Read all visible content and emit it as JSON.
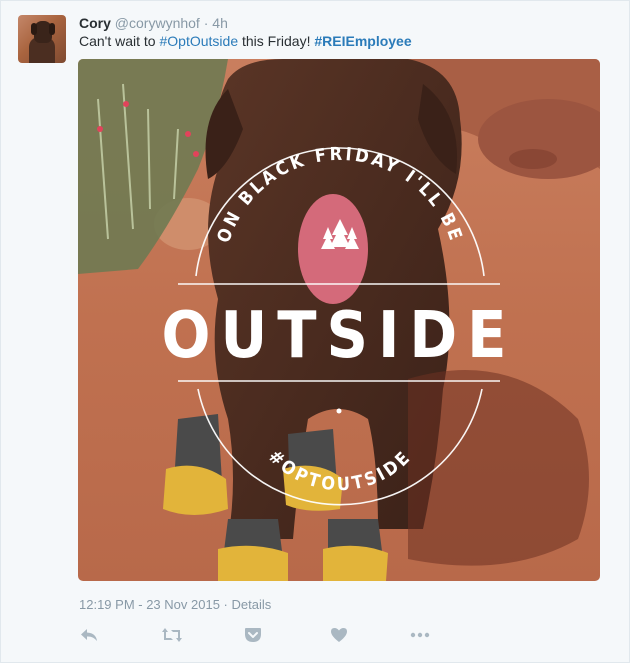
{
  "tweet": {
    "author": {
      "fullname": "Cory",
      "username": "@corywynhof",
      "separator": "·",
      "timestamp": "4h"
    },
    "text": {
      "prefix": "Can't wait to ",
      "hashtag1": "#OptOutside",
      "middle": " this Friday! ",
      "hashtag2": "#REIEmployee"
    },
    "media": {
      "overlay_top": "ON BLACK FRIDAY I'LL BE",
      "overlay_main": "OUTSIDE",
      "overlay_bottom": "#OPTOUTSIDE"
    },
    "meta": {
      "time": "12:19 PM - 23 Nov 2015",
      "separator": "·",
      "details_label": "Details"
    },
    "actions": [
      {
        "name": "reply-icon"
      },
      {
        "name": "retweet-icon"
      },
      {
        "name": "pocket-icon"
      },
      {
        "name": "like-icon"
      },
      {
        "name": "more-icon"
      }
    ],
    "colors": {
      "hashtag": "#2b7bb9",
      "muted": "#8899a6",
      "action_icon": "#aab8c2",
      "background": "#f5f8fa"
    }
  }
}
